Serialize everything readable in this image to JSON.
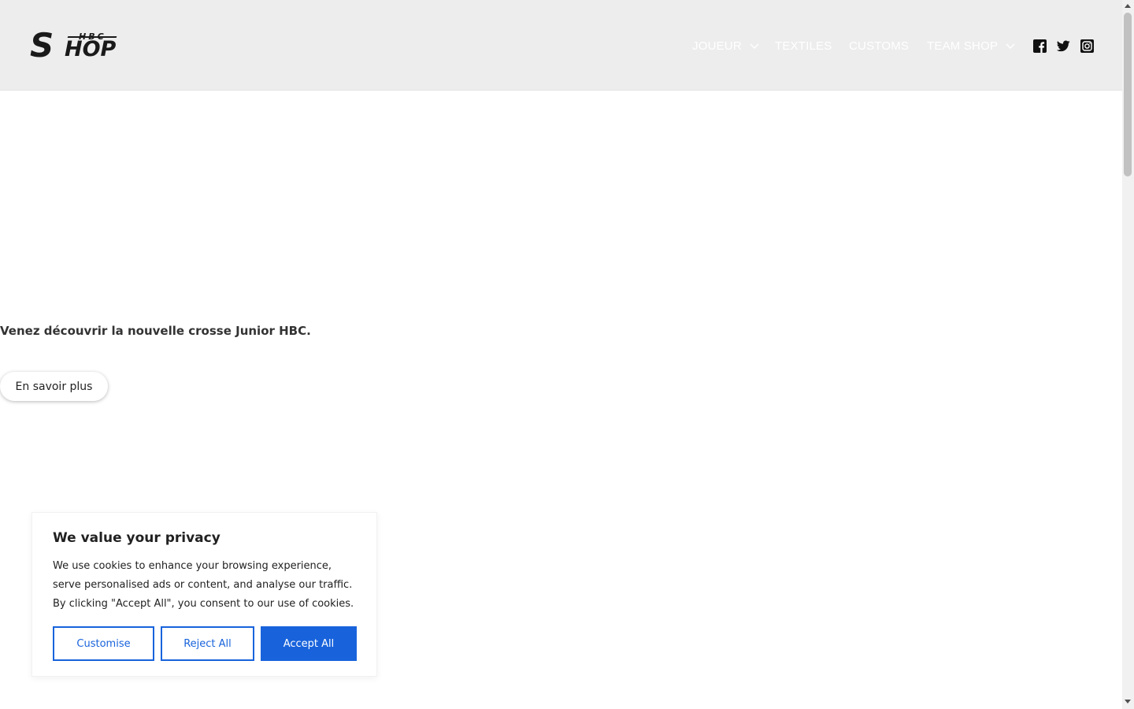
{
  "header": {
    "logo": {
      "small_text": "HBC",
      "big_text_initial": "S",
      "big_text_rest": "HOP"
    },
    "nav": [
      {
        "label": "JOUEUR",
        "has_dropdown": true
      },
      {
        "label": "TEXTILES",
        "has_dropdown": false
      },
      {
        "label": "CUSTOMS",
        "has_dropdown": false
      },
      {
        "label": "TEAM SHOP",
        "has_dropdown": true
      }
    ],
    "social": [
      {
        "icon": "facebook-icon"
      },
      {
        "icon": "twitter-icon"
      },
      {
        "icon": "instagram-icon"
      }
    ]
  },
  "hero": {
    "text": "Venez découvrir la nouvelle crosse Junior HBC.",
    "button_label": "En savoir plus"
  },
  "cookie_banner": {
    "title": "We value your privacy",
    "body": "We use cookies to enhance your browsing experience, serve personalised ads or content, and analyse our traffic. By clicking \"Accept All\", you consent to our use of cookies.",
    "customise_label": "Customise",
    "reject_label": "Reject All",
    "accept_label": "Accept All",
    "accent_color": "#1863dc"
  },
  "colors": {
    "header_bg": "#ededed",
    "nav_text": "#ffffff",
    "text_dark": "#333333"
  }
}
